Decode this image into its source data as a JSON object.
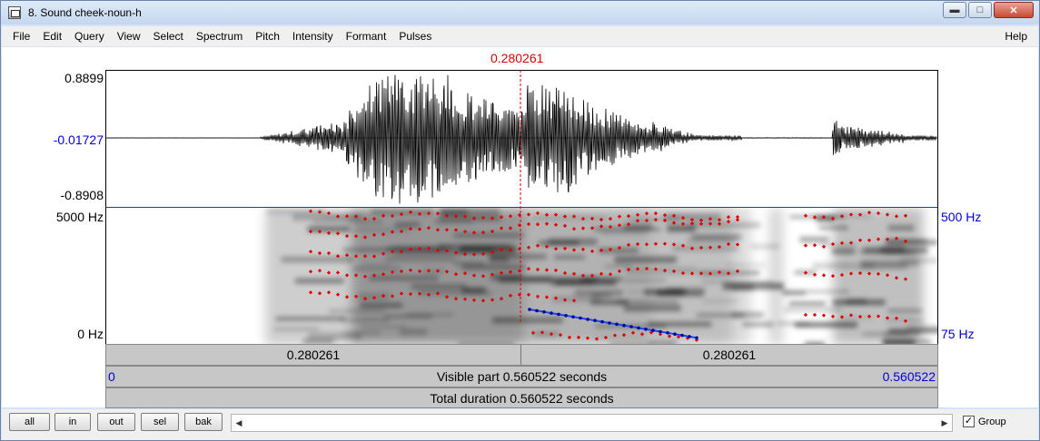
{
  "window": {
    "title": "8. Sound cheek-noun-h",
    "buttons": {
      "minimize": "▬",
      "maximize": "□",
      "close": "✕"
    }
  },
  "menu": {
    "items": [
      "File",
      "Edit",
      "Query",
      "View",
      "Select",
      "Spectrum",
      "Pitch",
      "Intensity",
      "Formant",
      "Pulses"
    ],
    "help": "Help"
  },
  "cursor": {
    "time": "0.280261"
  },
  "waveform": {
    "max": "0.8899",
    "zero": "-0.01727",
    "min": "-0.8908"
  },
  "spectrogram": {
    "top_freq": "5000 Hz",
    "bottom_freq": "0 Hz",
    "pitch_top": "500 Hz",
    "pitch_bottom": "75 Hz"
  },
  "bars": {
    "left_half": "0.280261",
    "right_half": "0.280261",
    "visible_start": "0",
    "visible_label": "Visible part 0.560522 seconds",
    "visible_end": "0.560522",
    "total_label": "Total duration 0.560522 seconds"
  },
  "nav": {
    "all": "all",
    "in": "in",
    "out": "out",
    "sel": "sel",
    "bak": "bak"
  },
  "group": {
    "label": "Group",
    "checked": "✓"
  },
  "colors": {
    "cursor": "#e00000",
    "axis_blue": "#0000d8",
    "formant": "#e00000",
    "pitch": "#1a4dd8"
  }
}
